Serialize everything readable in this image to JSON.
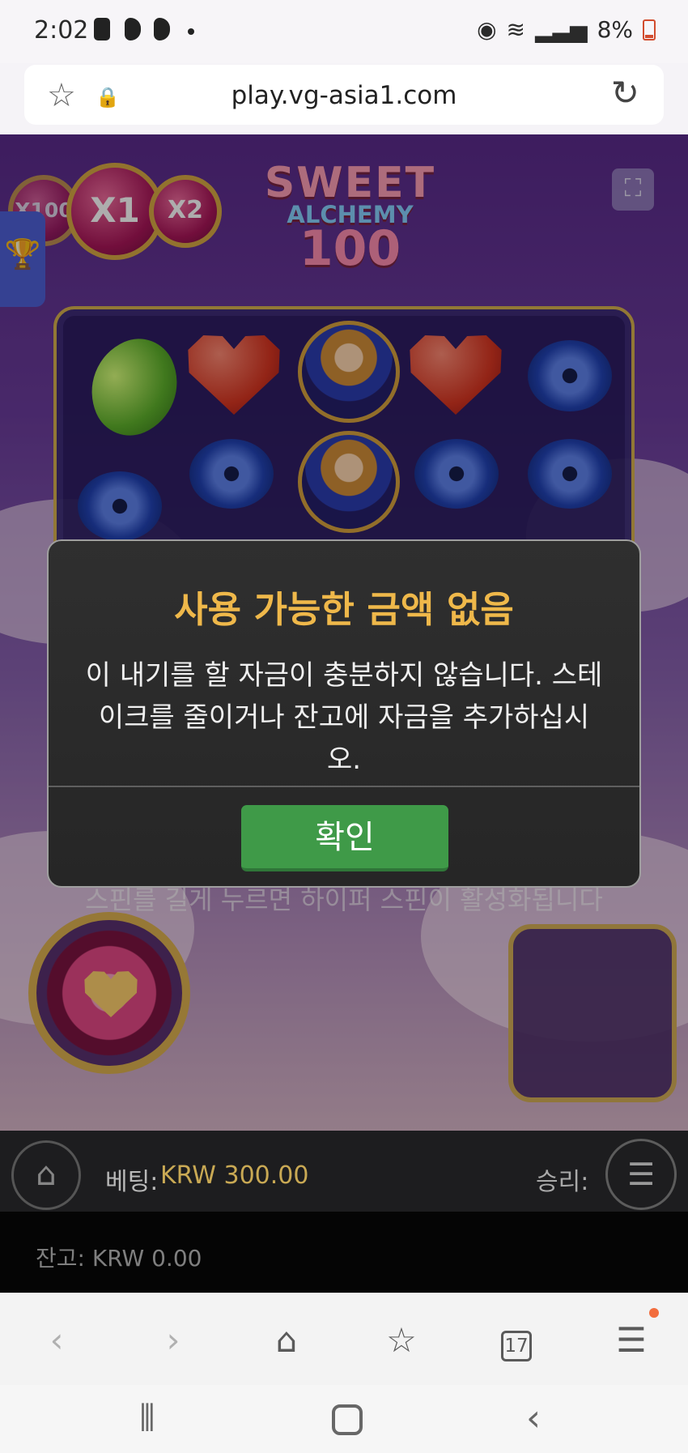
{
  "status_bar": {
    "time": "2:02",
    "battery": "8%"
  },
  "browser": {
    "url": "play.vg-asia1.com",
    "tab_count": "17"
  },
  "game": {
    "title_line1": "SWEET",
    "title_line2": "ALCHEMY",
    "title_line3": "100",
    "multipliers": [
      "X1",
      "X2",
      "X100"
    ],
    "hint_text": "스핀를 길게 누르면 하이퍼 스핀이 활성화됩니다",
    "bet_label": "베팅:",
    "bet_value": "KRW 300.00",
    "win_label": "승리:",
    "balance_label": "잔고: KRW 0.00"
  },
  "modal": {
    "title": "사용 가능한 금액 없음",
    "message_line1": "이 내기를 할 자금이 충분하지 않습니다. 스테",
    "message_line2": "이크를 줄이거나 잔고에 자금을 추가하십시오.",
    "confirm_label": "확인"
  },
  "icons": {
    "star": "star-icon",
    "lock": "lock-icon",
    "refresh": "refresh-icon",
    "fullscreen": "fullscreen-icon",
    "trophy": "trophy-icon",
    "home": "home-icon",
    "menu": "menu-icon"
  },
  "colors": {
    "game_purple": "#6b3c9c",
    "title_gold": "#efb84a",
    "confirm_green": "#3f9a48",
    "bet_gold": "#c9a954"
  }
}
